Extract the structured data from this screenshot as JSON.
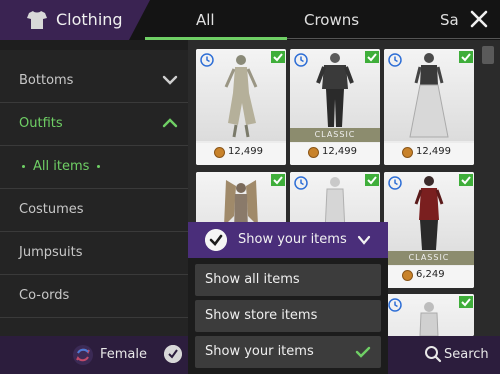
{
  "header": {
    "category_title": "Clothing",
    "category_icon": "shirt-icon",
    "tabs": [
      {
        "label": "All",
        "active": true
      },
      {
        "label": "Crowns",
        "active": false
      },
      {
        "label": "Sa",
        "active": false
      }
    ],
    "close_icon": "close-icon"
  },
  "sidebar": {
    "items": [
      {
        "label": "Bottoms",
        "state": "collapsed"
      },
      {
        "label": "Outfits",
        "state": "expanded"
      },
      {
        "label": "All items",
        "state": "selected"
      },
      {
        "label": "Costumes"
      },
      {
        "label": "Jumpsuits"
      },
      {
        "label": "Co-ords"
      }
    ]
  },
  "grid": {
    "cards": [
      {
        "price": "12,499",
        "classic": false
      },
      {
        "price": "12,499",
        "classic": true,
        "badge": "CLASSIC"
      },
      {
        "price": "12,499",
        "classic": false
      },
      {
        "price": "",
        "classic": false
      },
      {
        "price": "",
        "classic": false
      },
      {
        "price": "6,249",
        "classic": true,
        "badge": "CLASSIC"
      }
    ]
  },
  "dropdown": {
    "title": "Show your items",
    "options": [
      {
        "label": "Show all items",
        "selected": false
      },
      {
        "label": "Show store items",
        "selected": false
      },
      {
        "label": "Show your items",
        "selected": true
      }
    ]
  },
  "footer": {
    "gender_label": "Female",
    "search_label": "Search"
  },
  "colors": {
    "accent_green": "#6fcf65",
    "purple": "#4a2e7a",
    "bar_purple": "#2c1d3d"
  }
}
